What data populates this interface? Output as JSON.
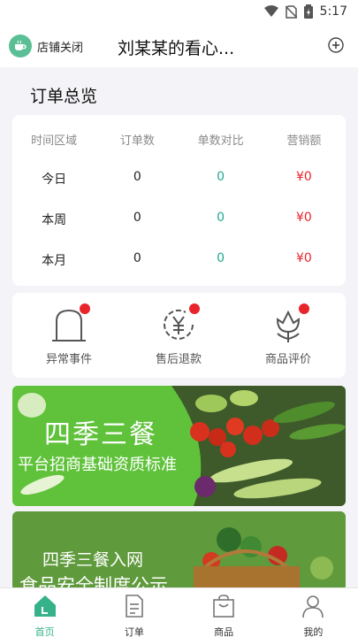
{
  "status_bar": {
    "time": "5:17"
  },
  "header": {
    "store_status": "店铺关闭",
    "store_name": "刘某某的看心..."
  },
  "overview": {
    "title": "订单总览",
    "headers": [
      "时间区域",
      "订单数",
      "单数对比",
      "营销额"
    ],
    "rows": [
      {
        "period": "今日",
        "orders": "0",
        "compare": "0",
        "sales": "¥0"
      },
      {
        "period": "本周",
        "orders": "0",
        "compare": "0",
        "sales": "¥0"
      },
      {
        "period": "本月",
        "orders": "0",
        "compare": "0",
        "sales": "¥0"
      }
    ]
  },
  "events": [
    {
      "label": "异常事件",
      "icon": "tombstone-icon"
    },
    {
      "label": "售后退款",
      "icon": "yen-refresh-icon"
    },
    {
      "label": "商品评价",
      "icon": "flower-icon"
    }
  ],
  "banners": [
    {
      "title": "四季三餐",
      "subtitle": "平台招商基础资质标准"
    },
    {
      "title": "四季三餐入网",
      "subtitle": "食品安全制度公示"
    }
  ],
  "bottom_nav": [
    {
      "label": "首页",
      "icon": "home-icon",
      "active": true
    },
    {
      "label": "订单",
      "icon": "order-icon",
      "active": false
    },
    {
      "label": "商品",
      "icon": "bag-icon",
      "active": false
    },
    {
      "label": "我的",
      "icon": "user-icon",
      "active": false
    }
  ],
  "colors": {
    "accent": "#35b28a",
    "compare": "#24a88f",
    "sales": "#e8242a",
    "badge": "#e8242a"
  }
}
